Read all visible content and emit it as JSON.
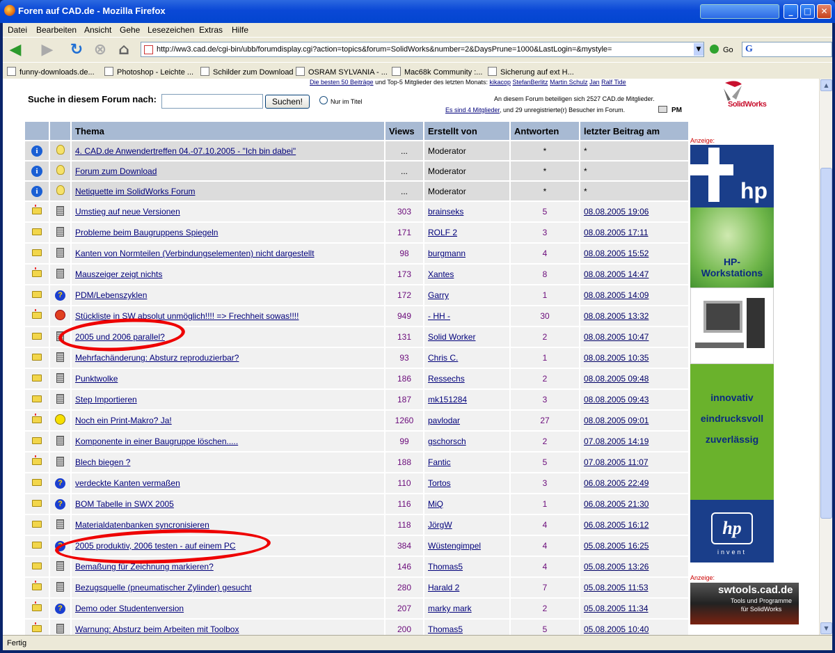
{
  "window": {
    "title": "Foren auf CAD.de - Mozilla Firefox"
  },
  "menu": [
    "Datei",
    "Bearbeiten",
    "Ansicht",
    "Gehe",
    "Lesezeichen",
    "Extras",
    "Hilfe"
  ],
  "nav": {
    "url": "http://ww3.cad.de/cgi-bin/ubb/forumdisplay.cgi?action=topics&forum=SolidWorks&number=2&DaysPrune=1000&LastLogin=&mystyle=",
    "go": "Go"
  },
  "bookmarks": [
    "funny-downloads.de...",
    "Photoshop - Leichte ...",
    "Schilder zum Download",
    "OSRAM SYLVANIA - ...",
    "Mac68k Community :...",
    "Sicherung auf ext H..."
  ],
  "page": {
    "toplinks": {
      "prefix_link": "Die besten 50 Beiträge",
      "middle": " und Top-5 Mitglieder des letzten Monats: ",
      "members": [
        "kikacop",
        "StefanBerlitz",
        "Martin Schulz",
        "Jan",
        "Ralf Tide"
      ]
    },
    "info1": "An diesem Forum beteiligen sich 2527 CAD.de Mitglieder.",
    "info2_link": "Es sind 4 Mitglieder",
    "info2_rest": ", und 29 unregistrierte(r) Besucher im Forum.",
    "pm": "PM",
    "search_label": "Suche in diesem Forum nach:",
    "search_button": "Suchen!",
    "search_option": "Nur im Titel",
    "logo_text": "SolidWorks",
    "ad_label": "Anzeige:",
    "ad1": {
      "hp_text": "hp",
      "workstations": "HP-\nWorkstations",
      "line1": "innovativ",
      "line2": "eindrucksvoll",
      "line3": "zuverlässig",
      "invent": "invent",
      "hp_logo": "hp"
    },
    "ad2": {
      "title": "swtools.cad.de",
      "sub": "Tools und Programme\nfür SolidWorks"
    }
  },
  "table": {
    "headers": {
      "thema": "Thema",
      "views": "Views",
      "author": "Erstellt von",
      "answers": "Antworten",
      "last": "letzter Beitrag am"
    },
    "rows": [
      {
        "icon": "info",
        "sub": "bulb",
        "topic": "4. CAD.de Anwendertreffen 04.-07.10.2005 - \"Ich bin dabei\"",
        "views": "...",
        "author": "Moderator",
        "answers": "*",
        "last": "*",
        "sticky": true
      },
      {
        "icon": "info",
        "sub": "bulb",
        "topic": "Forum zum Download",
        "views": "...",
        "author": "Moderator",
        "answers": "*",
        "last": "*",
        "sticky": true
      },
      {
        "icon": "info",
        "sub": "bulb",
        "topic": "Netiquette im SolidWorks Forum",
        "views": "...",
        "author": "Moderator",
        "answers": "*",
        "last": "*",
        "sticky": true
      },
      {
        "icon": "folder-hot",
        "sub": "doc",
        "topic": "Umstieg auf neue Versionen",
        "views": "303",
        "author": "brainseks",
        "answers": "5",
        "last": "08.08.2005 19:06"
      },
      {
        "icon": "folder",
        "sub": "doc",
        "topic": "Probleme beim Baugruppens Spiegeln",
        "views": "171",
        "author": "ROLF 2",
        "answers": "3",
        "last": "08.08.2005 17:11"
      },
      {
        "icon": "folder",
        "sub": "doc",
        "topic": "Kanten von Normteilen (Verbindungselementen) nicht dargestellt",
        "views": "98",
        "author": "burgmann",
        "answers": "4",
        "last": "08.08.2005 15:52"
      },
      {
        "icon": "folder-hot",
        "sub": "doc",
        "topic": "Mauszeiger zeigt nichts",
        "views": "173",
        "author": "Xantes",
        "answers": "8",
        "last": "08.08.2005 14:47"
      },
      {
        "icon": "folder",
        "sub": "q",
        "topic": "PDM/Lebenszyklen",
        "views": "172",
        "author": "Garry",
        "answers": "1",
        "last": "08.08.2005 14:09"
      },
      {
        "icon": "folder-hot",
        "sub": "angry",
        "topic": "Stückliste in SW absolut unmöglich!!!! => Frechheit sowas!!!!",
        "views": "949",
        "author": "- HH -",
        "answers": "30",
        "last": "08.08.2005 13:32"
      },
      {
        "icon": "folder",
        "sub": "doc",
        "topic": "2005 und 2006 parallel?",
        "views": "131",
        "author": "Solid Worker",
        "answers": "2",
        "last": "08.08.2005 10:47"
      },
      {
        "icon": "folder",
        "sub": "doc",
        "topic": "Mehrfachänderung: Absturz reproduzierbar?",
        "views": "93",
        "author": "Chris C.",
        "answers": "1",
        "last": "08.08.2005 10:35"
      },
      {
        "icon": "folder",
        "sub": "doc",
        "topic": "Punktwolke",
        "views": "186",
        "author": "Ressechs",
        "answers": "2",
        "last": "08.08.2005 09:48"
      },
      {
        "icon": "folder",
        "sub": "doc",
        "topic": "Step Importieren",
        "views": "187",
        "author": "mk151284",
        "answers": "3",
        "last": "08.08.2005 09:43"
      },
      {
        "icon": "folder-hot",
        "sub": "smile",
        "topic": "Noch ein Print-Makro? Ja!",
        "views": "1260",
        "author": "pavlodar",
        "answers": "27",
        "last": "08.08.2005 09:01"
      },
      {
        "icon": "folder",
        "sub": "doc",
        "topic": "Komponente in einer Baugruppe löschen.....",
        "views": "99",
        "author": "gschorsch",
        "answers": "2",
        "last": "07.08.2005 14:19"
      },
      {
        "icon": "folder-hot",
        "sub": "doc",
        "topic": "Blech biegen ?",
        "views": "188",
        "author": "Fantic",
        "answers": "5",
        "last": "07.08.2005 11:07"
      },
      {
        "icon": "folder",
        "sub": "q",
        "topic": "verdeckte Kanten vermaßen",
        "views": "110",
        "author": "Tortos",
        "answers": "3",
        "last": "06.08.2005 22:49"
      },
      {
        "icon": "folder",
        "sub": "q",
        "topic": "BOM Tabelle in SWX 2005",
        "views": "116",
        "author": "MiQ",
        "answers": "1",
        "last": "06.08.2005 21:30"
      },
      {
        "icon": "folder",
        "sub": "doc",
        "topic": "Materialdatenbanken syncronisieren",
        "views": "118",
        "author": "JörgW",
        "answers": "4",
        "last": "06.08.2005 16:12"
      },
      {
        "icon": "folder",
        "sub": "q",
        "topic": "2005 produktiv, 2006 testen - auf einem PC",
        "views": "384",
        "author": "Wüstengimpel",
        "answers": "4",
        "last": "05.08.2005 16:25"
      },
      {
        "icon": "folder",
        "sub": "doc",
        "topic": "Bemaßung für Zeichnung markieren?",
        "views": "146",
        "author": "Thomas5",
        "answers": "4",
        "last": "05.08.2005 13:26"
      },
      {
        "icon": "folder-hot",
        "sub": "doc",
        "topic": "Bezugsquelle (pneumatischer Zylinder) gesucht",
        "views": "280",
        "author": "Harald 2",
        "answers": "7",
        "last": "05.08.2005 11:53"
      },
      {
        "icon": "folder-hot",
        "sub": "q",
        "topic": "Demo oder Studentenversion",
        "views": "207",
        "author": "marky mark",
        "answers": "2",
        "last": "05.08.2005 11:34"
      },
      {
        "icon": "folder-hot",
        "sub": "doc",
        "topic": "Warnung: Absturz beim Arbeiten mit Toolbox",
        "views": "200",
        "author": "Thomas5",
        "answers": "5",
        "last": "05.08.2005 10:40"
      }
    ]
  },
  "status": "Fertig"
}
